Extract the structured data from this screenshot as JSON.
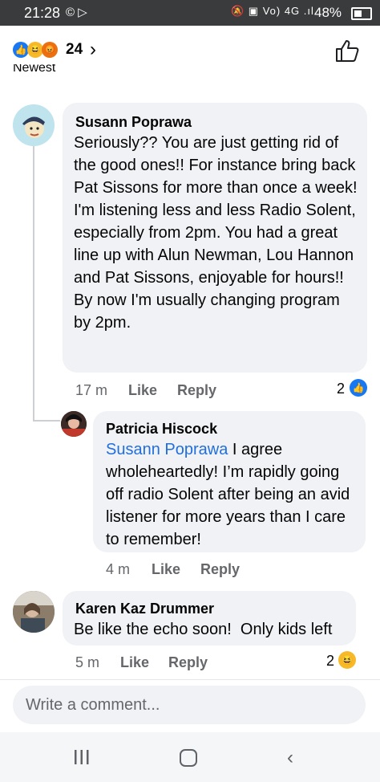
{
  "status_bar": {
    "time": "21:28",
    "left_icons_text": "© ▷",
    "right_icons_text": "🔕 ▣ Vo) 4G .ıl",
    "battery": "48%"
  },
  "reactions_header": {
    "count": "24",
    "chevron": "›",
    "cut_text": "Newest"
  },
  "comments": [
    {
      "author": "Susann Poprawa",
      "text": "Seriously?? You are just getting rid of the good ones!! For instance bring back Pat Sissons for more than once a week!\nI'm listening less and less Radio Solent, especially from 2pm. You had a great line up with Alun Newman, Lou Hannon and Pat Sissons, enjoyable for hours!!\nBy now I'm usually changing program by 2pm.",
      "time": "17 m",
      "like_label": "Like",
      "reply_label": "Reply",
      "reaction_count": "2"
    },
    {
      "author": "Patricia Hiscock",
      "mention": "Susann Poprawa",
      "text": " I agree wholeheartedly! I’m rapidly going off radio Solent after being an avid listener for more years than I care to remember!",
      "time": "4 m",
      "like_label": "Like",
      "reply_label": "Reply"
    },
    {
      "author": "Karen Kaz Drummer",
      "text": "Be like the echo soon!  Only kids left",
      "time": "5 m",
      "like_label": "Like",
      "reply_label": "Reply",
      "reaction_count": "2"
    }
  ],
  "composer": {
    "placeholder": "Write a comment..."
  },
  "nav": {
    "recent_icon": "recent-apps-icon",
    "home_icon": "home-icon",
    "back_icon": "back-icon"
  },
  "colors": {
    "status_bar_bg": "#3a3b3c",
    "bubble_bg": "#f0f2f5",
    "mention": "#216fdb",
    "meta_text": "#65676b",
    "like_blue": "#1877f2"
  }
}
